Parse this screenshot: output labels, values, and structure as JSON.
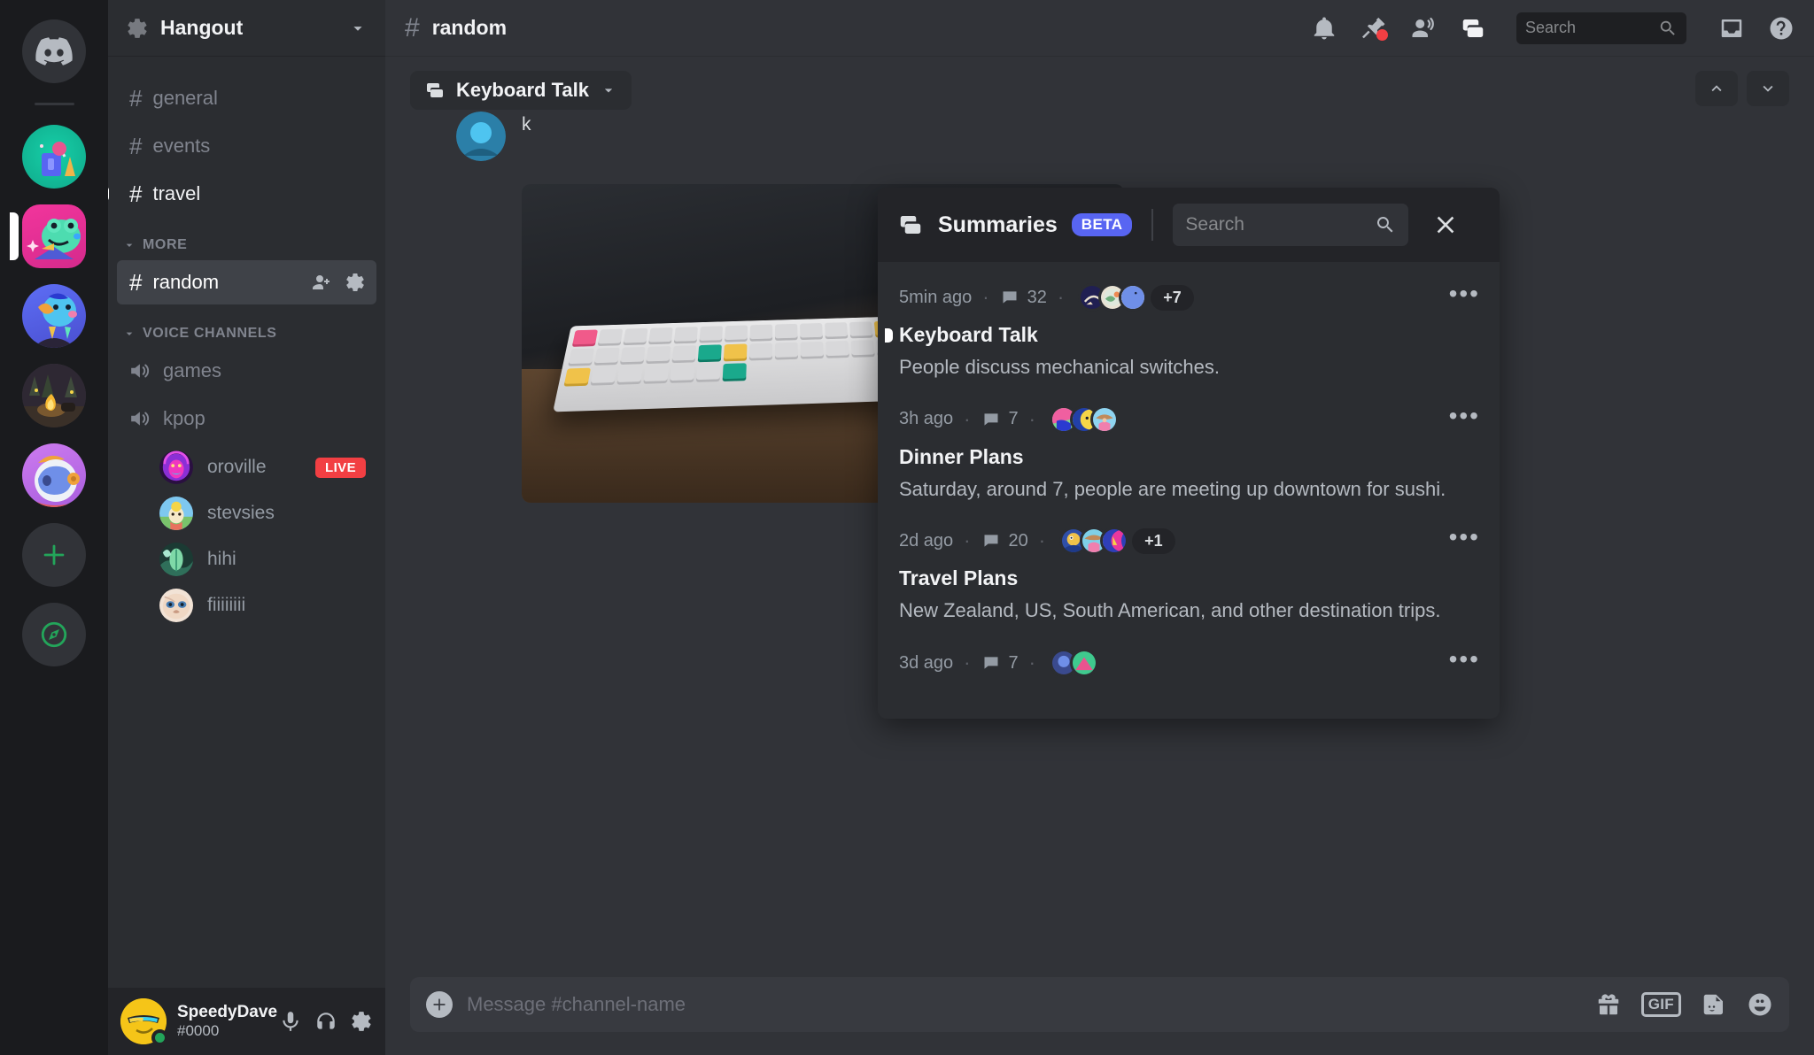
{
  "server_rail": {
    "home_icon": "discord-logo",
    "guilds": [
      {
        "name": "camping-guild",
        "selected": false,
        "colors": [
          "#15c0a0",
          "#5865f2",
          "#e8a33d"
        ]
      },
      {
        "name": "frog-guild",
        "selected": true,
        "colors": [
          "#ee3ba0",
          "#3fd4b0",
          "#4f5bd5"
        ]
      },
      {
        "name": "blue-character-guild",
        "selected": false,
        "colors": [
          "#5865f2",
          "#4ec4f0",
          "#f0a23b"
        ]
      },
      {
        "name": "campfire-guild",
        "selected": false,
        "colors": [
          "#3a3024",
          "#f0a23b",
          "#2a2418"
        ]
      },
      {
        "name": "astronaut-guild",
        "selected": false,
        "colors": [
          "#c06ce8",
          "#eef1f7",
          "#5865f2"
        ]
      }
    ],
    "add_server_label": "+",
    "explore_label": "compass"
  },
  "sidebar": {
    "server_name": "Hangout",
    "server_icon": "gear-icon",
    "dropdown_icon": "chevron-down-icon",
    "channels": [
      {
        "name": "general",
        "type": "text",
        "state": "read"
      },
      {
        "name": "events",
        "type": "text",
        "state": "read"
      },
      {
        "name": "travel",
        "type": "text",
        "state": "unread"
      }
    ],
    "categories": [
      {
        "label": "MORE",
        "channels": [
          {
            "name": "random",
            "type": "text",
            "state": "active",
            "actions": [
              "add-member-icon",
              "settings-icon"
            ]
          }
        ]
      },
      {
        "label": "VOICE CHANNELS",
        "channels": [
          {
            "name": "games",
            "type": "voice",
            "state": "read",
            "members": []
          },
          {
            "name": "kpop",
            "type": "voice",
            "state": "read",
            "members": [
              {
                "name": "oroville",
                "badge": "LIVE",
                "colors": [
                  "#8b2fd6",
                  "#ef37c0",
                  "#2a1040"
                ]
              },
              {
                "name": "stevsies",
                "badge": "",
                "colors": [
                  "#7ec8f0",
                  "#f5d547",
                  "#79c36b"
                ]
              },
              {
                "name": "hihi",
                "badge": "",
                "colors": [
                  "#2f5f52",
                  "#7fd9a8",
                  "#1b3a33"
                ]
              },
              {
                "name": "fiiiiiiii",
                "badge": "",
                "colors": [
                  "#f0ded0",
                  "#d8b9a6",
                  "#4a7fb5"
                ]
              }
            ]
          }
        ]
      }
    ],
    "user": {
      "name": "SpeedyDave",
      "tag": "#0000",
      "status": "online",
      "status_color": "#23a55a",
      "controls": [
        "microphone-icon",
        "headphones-icon",
        "settings-icon"
      ]
    }
  },
  "topbar": {
    "channel_hash": "#",
    "channel_name": "random",
    "icons": [
      {
        "name": "notification-bell-icon",
        "badge": false
      },
      {
        "name": "pinned-messages-icon",
        "badge": true
      },
      {
        "name": "members-list-icon",
        "badge": false
      },
      {
        "name": "summaries-icon",
        "badge": false,
        "active": true
      }
    ],
    "search": {
      "placeholder": "Search",
      "value": "",
      "icon": "search-icon"
    },
    "inbox_icon": "inbox-icon",
    "help_icon": "help-icon"
  },
  "chat": {
    "thread_chip": {
      "label": "Keyboard Talk",
      "icon": "thread-icon",
      "chevron": "chevron-down-icon"
    },
    "jump_up_icon": "chevron-up-icon",
    "jump_down_icon": "chevron-down-icon",
    "messages": [
      {
        "text": "k",
        "has_image": false
      },
      {
        "text": "",
        "has_image": true,
        "image_alt": "white mechanical keyboard with colored keycaps on wooden desk"
      }
    ]
  },
  "summaries_panel": {
    "title": "Summaries",
    "badge": "BETA",
    "icon": "summaries-icon",
    "search": {
      "placeholder": "Search",
      "value": "",
      "icon": "search-icon"
    },
    "close_icon": "close-icon",
    "more_icon": "overflow-menu-icon",
    "items": [
      {
        "time": "5min ago",
        "message_count": "32",
        "message_icon": "comment-icon",
        "avatars": [
          "#2b2d6e",
          "#e8e0d0",
          "#6f8fe8"
        ],
        "extra_count": "+7",
        "title": "Keyboard Talk",
        "description": "People discuss mechanical switches.",
        "unread": true
      },
      {
        "time": "3h ago",
        "message_count": "7",
        "message_icon": "comment-icon",
        "avatars": [
          "#f05fa0",
          "#f5d547",
          "#f0a6c8"
        ],
        "extra_count": "",
        "title": "Dinner Plans",
        "description": "Saturday, around 7, people are meeting up downtown for sushi.",
        "unread": false
      },
      {
        "time": "2d ago",
        "message_count": "20",
        "message_icon": "comment-icon",
        "avatars": [
          "#5a7fd6",
          "#f0b890",
          "#d63fa0"
        ],
        "extra_count": "+1",
        "title": "Travel Plans",
        "description": "New Zealand, US,  South American, and other destination trips.",
        "unread": false
      },
      {
        "time": "3d ago",
        "message_count": "7",
        "message_icon": "comment-icon",
        "avatars": [
          "#3a4a8e",
          "#3fc98e"
        ],
        "extra_count": "",
        "title": "",
        "description": "",
        "unread": false
      }
    ]
  },
  "composer": {
    "placeholder": "Message #channel-name",
    "value": "",
    "add_icon": "plus-icon",
    "gift_icon": "gift-icon",
    "gif_label": "GIF",
    "sticker_icon": "sticker-icon",
    "emoji_icon": "emoji-icon"
  }
}
